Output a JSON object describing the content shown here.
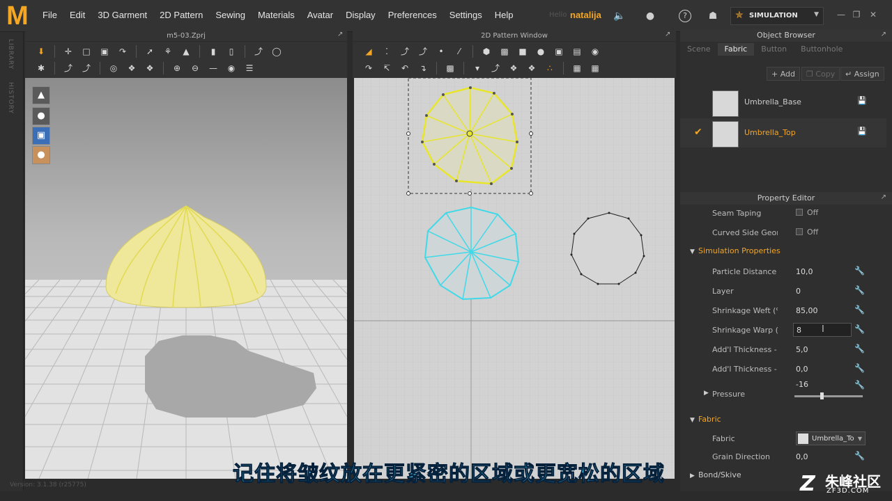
{
  "app": {
    "logo": "M",
    "menus": [
      "File",
      "Edit",
      "3D Garment",
      "2D Pattern",
      "Sewing",
      "Materials",
      "Avatar",
      "Display",
      "Preferences",
      "Settings",
      "Help"
    ],
    "hello": "Hello",
    "username": "natalija",
    "mode": "SIMULATION",
    "version": "Version: 3.1.38 (r25775)",
    "colors": {
      "accent": "#f5a623",
      "pattern_selected": "#e8e62a",
      "pattern_cyan": "#3fd9e8"
    }
  },
  "sidebar": {
    "library": "LIBRARY",
    "history": "HISTORY"
  },
  "viewport3d": {
    "title": "m5-03.Zprj",
    "icons": [
      "garment-icon",
      "avatar-icon",
      "texture-icon",
      "avatar-skin-icon"
    ]
  },
  "pattern2d": {
    "title": "2D Pattern Window"
  },
  "object_browser": {
    "title": "Object Browser",
    "tabs": [
      "Scene",
      "Fabric",
      "Button",
      "Buttonhole"
    ],
    "active_tab": "Fabric",
    "actions": {
      "add": "Add",
      "copy": "Copy",
      "assign": "Assign"
    },
    "fabrics": [
      {
        "name": "Umbrella_Base",
        "selected": false
      },
      {
        "name": "Umbrella_Top",
        "selected": true
      }
    ]
  },
  "property_editor": {
    "title": "Property Editor",
    "seam_taping": {
      "label": "Seam Taping",
      "value": "Off"
    },
    "curved_side": {
      "label": "Curved Side Geome",
      "value": "Off"
    },
    "sim_section": "Simulation Properties",
    "particle_distance": {
      "label": "Particle Distance (m",
      "value": "10,0"
    },
    "layer": {
      "label": "Layer",
      "value": "0"
    },
    "shrink_weft": {
      "label": "Shrinkage Weft (%",
      "value": "85,00"
    },
    "shrink_warp": {
      "label": "Shrinkage Warp (%",
      "value": "8"
    },
    "thick_collision": {
      "label": "Add'l Thickness - Collisic",
      "value": "5,0"
    },
    "thick_render": {
      "label": "Add'l Thickness - Render",
      "value": "0,0"
    },
    "pressure": {
      "label": "Pressure",
      "value": "-16",
      "slider_fraction": 0.4
    },
    "fabric_section": "Fabric",
    "fabric": {
      "label": "Fabric",
      "value": "Umbrella_To"
    },
    "grain": {
      "label": "Grain Direction",
      "value": "0,0"
    },
    "bond_section": "Bond/Skive"
  },
  "subtitle": "记住将皱纹放在更紧密的区域或更宽松的区域",
  "watermark": {
    "title": "朱峰社区",
    "site": "ZF3D.COM"
  }
}
